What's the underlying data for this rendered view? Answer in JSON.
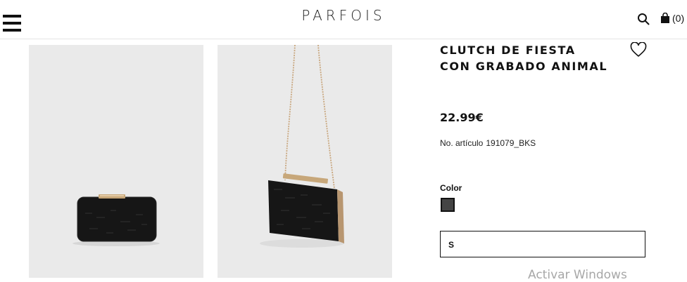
{
  "header": {
    "brand": "PARFOIS",
    "cart_count": "(0)",
    "menu_icon": "hamburger-menu-icon",
    "search_icon": "search-icon",
    "cart_icon": "shopping-bag-icon"
  },
  "gallery": {
    "images": [
      {
        "name": "clutch-front-view",
        "bag_color": "#161616",
        "clasp_color": "#c7a77a"
      },
      {
        "name": "clutch-chain-view",
        "bag_color": "#161616",
        "chain_color": "#c9a77f"
      }
    ],
    "background": "#eaeaea"
  },
  "product": {
    "title": "CLUTCH DE FIESTA CON GRABADO ANIMAL",
    "price": "22.99€",
    "sku_label": "No. artículo",
    "sku": "191079_BKS",
    "color_label": "Color",
    "color_swatch": "#444444",
    "size_selected": "S",
    "wishlist_icon": "heart-icon"
  },
  "os_watermark": "Activar Windows"
}
